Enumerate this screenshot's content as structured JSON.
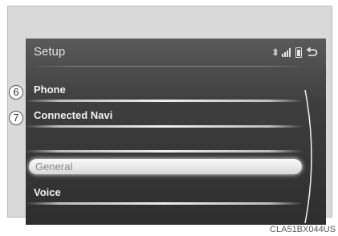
{
  "header": {
    "title": "Setup"
  },
  "status_icons": [
    "bluetooth-icon",
    "signal-strength-icon",
    "phone-battery-icon",
    "back-arrow-icon"
  ],
  "menu": {
    "items": [
      {
        "label": "Phone",
        "callout": "6"
      },
      {
        "label": "Connected Navi",
        "callout": "7"
      },
      {
        "label": ""
      },
      {
        "label": "General",
        "selected": true
      },
      {
        "label": "Voice"
      }
    ]
  },
  "caption": "CLA51BX044US",
  "colors": {
    "screen_bg": "#3e3e3e",
    "selected_bg": "#f2f2f2",
    "text": "#f2f2f2"
  }
}
